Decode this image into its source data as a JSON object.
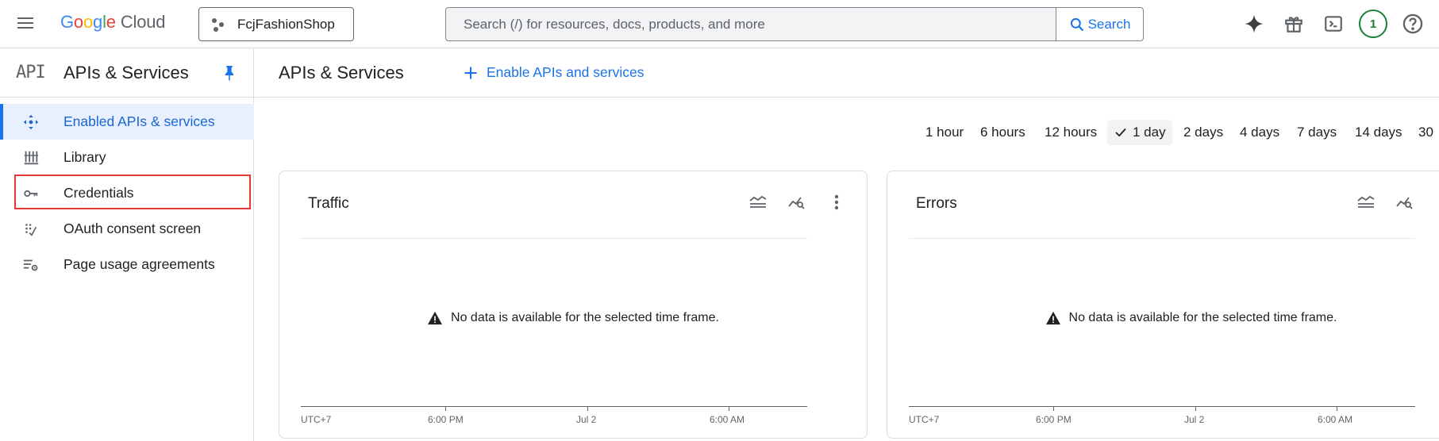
{
  "topbar": {
    "logo": {
      "letters": [
        "G",
        "o",
        "o",
        "g",
        "l",
        "e"
      ],
      "product": "Cloud"
    },
    "project_name": "FcjFashionShop",
    "search": {
      "placeholder": "Search (/) for resources, docs, products, and more",
      "button_label": "Search"
    },
    "avatar_initial": "1",
    "icons": [
      "gemini-icon",
      "gift-icon",
      "cloud-shell-icon",
      "avatar",
      "help-icon"
    ]
  },
  "sidebar": {
    "product_logo": "API",
    "title": "APIs & Services",
    "items": [
      {
        "label": "Enabled APIs & services",
        "icon": "enabled-apis-icon",
        "active": true
      },
      {
        "label": "Library",
        "icon": "library-icon",
        "active": false
      },
      {
        "label": "Credentials",
        "icon": "key-icon",
        "active": false,
        "highlighted": true
      },
      {
        "label": "OAuth consent screen",
        "icon": "oauth-icon",
        "active": false
      },
      {
        "label": "Page usage agreements",
        "icon": "settings-list-icon",
        "active": false
      }
    ]
  },
  "main": {
    "title": "APIs & Services",
    "enable_button": "Enable APIs and services",
    "time_ranges": [
      "1 hour",
      "6 hours",
      "12 hours",
      "1 day",
      "2 days",
      "4 days",
      "7 days",
      "14 days",
      "30"
    ],
    "selected_range": "1 day",
    "cards": [
      {
        "title": "Traffic",
        "message": "No data is available for the selected time frame.",
        "x_ticks": [
          "UTC+7",
          "6:00 PM",
          "Jul 2",
          "6:00 AM"
        ]
      },
      {
        "title": "Errors",
        "message": "No data is available for the selected time frame.",
        "x_ticks": [
          "UTC+7",
          "6:00 PM",
          "Jul 2",
          "6:00 AM"
        ]
      }
    ]
  },
  "colors": {
    "accent": "#1a73e8",
    "active_bg": "#e8f0fe",
    "highlight_border": "#e53935",
    "avatar": "#188038"
  }
}
